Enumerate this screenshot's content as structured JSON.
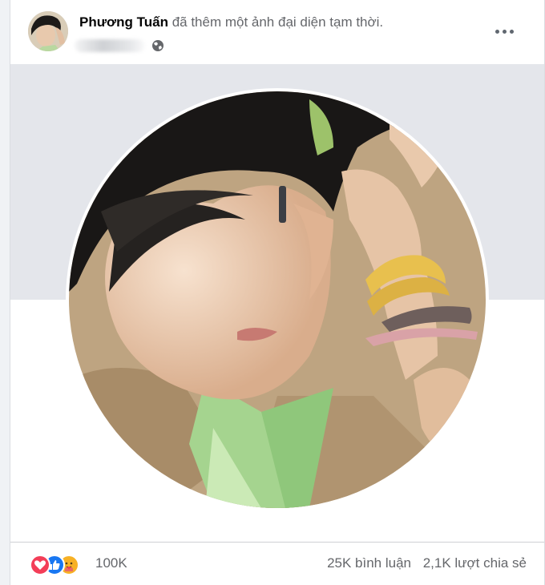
{
  "post": {
    "author": "Phương Tuấn",
    "action_text": " đã thêm một ảnh đại diện tạm thời.",
    "privacy_icon": "globe-icon",
    "menu_icon": "more-horizontal-icon"
  },
  "footer": {
    "reactions": [
      "love-reaction-icon",
      "like-reaction-icon",
      "care-reaction-icon"
    ],
    "reaction_count": "100K",
    "comments": "25K bình luận",
    "shares": "2,1K lượt chia sẻ"
  },
  "colors": {
    "page_bg": "#f0f2f5",
    "card_bg": "#ffffff",
    "cover_bg": "#e4e6eb",
    "text_primary": "#050505",
    "text_secondary": "#65676b",
    "love": "#f33e58",
    "like": "#1877f2",
    "care": "#f7b125"
  }
}
